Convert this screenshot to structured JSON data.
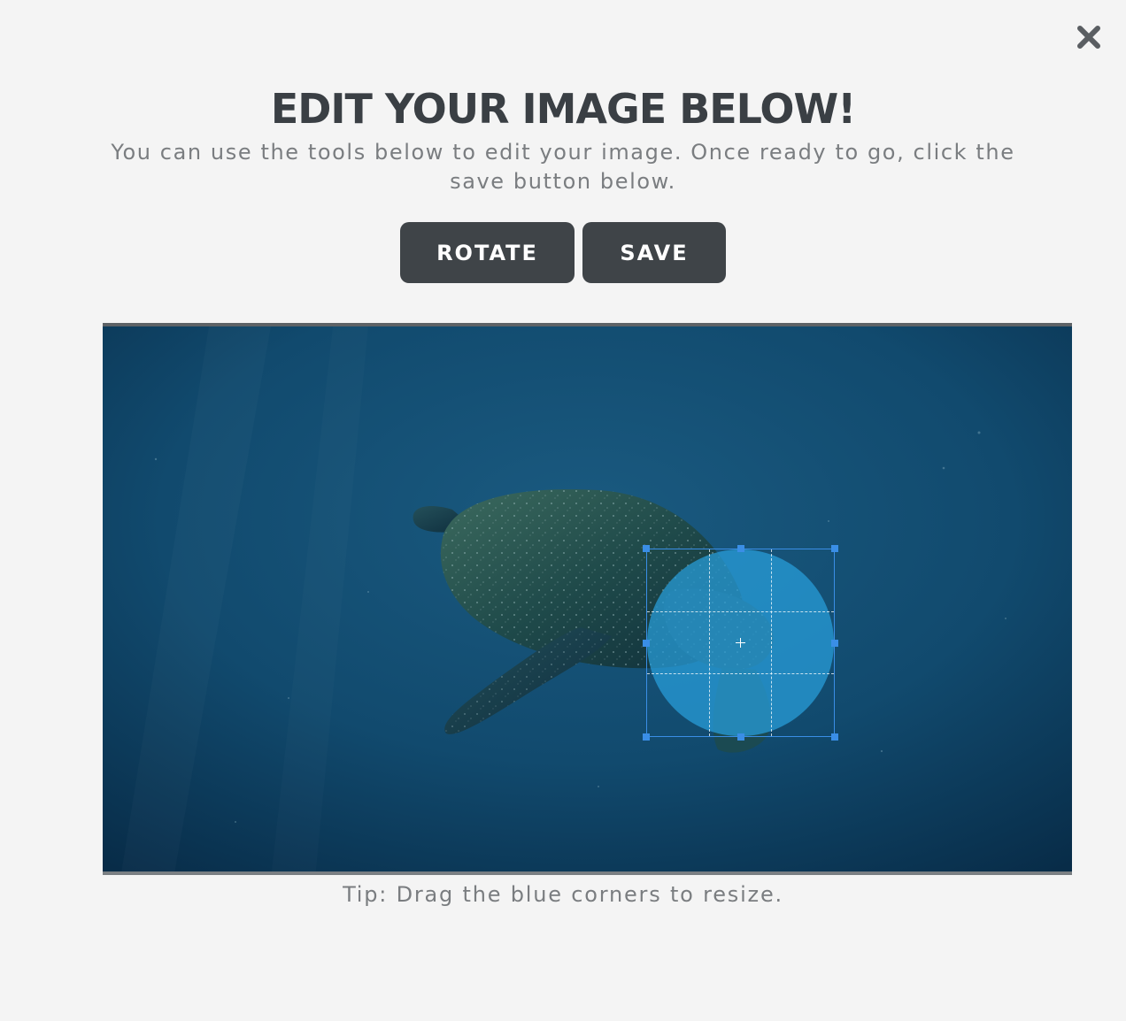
{
  "modal": {
    "close_icon": "close-icon",
    "title": "EDIT YOUR IMAGE BELOW!",
    "subtitle": "You can use the tools below to edit your image. Once ready to go, click the save button below.",
    "tip": "Tip: Drag the blue corners to resize."
  },
  "toolbar": {
    "rotate_label": "ROTATE",
    "save_label": "SAVE"
  },
  "editor": {
    "image_subject": "sea turtle swimming underwater",
    "crop_shape": "circle",
    "colors": {
      "accent": "#3a8ee6",
      "crop_overlay": "#28a0dc",
      "button_bg": "#3f4448",
      "title": "#3a3f44",
      "background": "#f4f4f4"
    }
  }
}
